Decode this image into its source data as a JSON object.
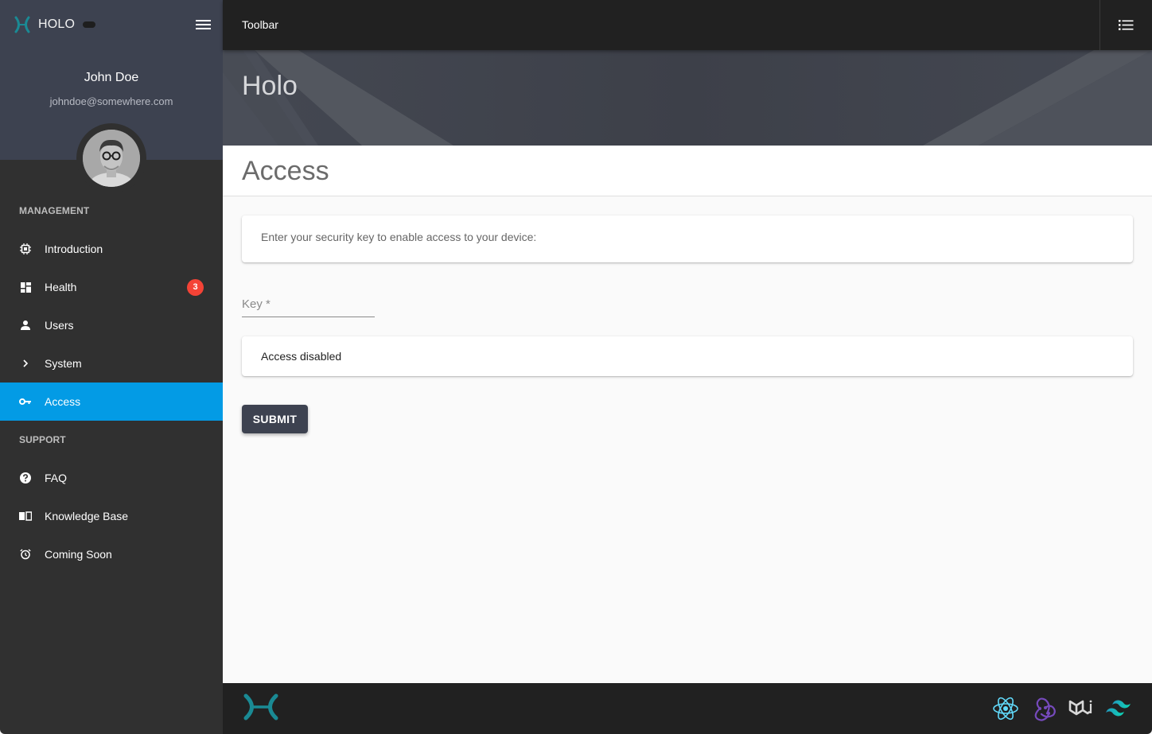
{
  "app": {
    "brand_name": "HOLO",
    "accent_color": "#039be5",
    "brand_color": "#1a8a94"
  },
  "sidebar": {
    "user": {
      "name": "John Doe",
      "email": "johndoe@somewhere.com"
    },
    "sections": [
      {
        "label": "MANAGEMENT",
        "items": [
          {
            "label": "Introduction",
            "icon": "chip-icon",
            "active": false
          },
          {
            "label": "Health",
            "icon": "dashboard-icon",
            "badge": "3",
            "active": false
          },
          {
            "label": "Users",
            "icon": "person-icon",
            "active": false
          },
          {
            "label": "System",
            "icon": "chevron-right-icon",
            "active": false
          },
          {
            "label": "Access",
            "icon": "key-icon",
            "active": true
          }
        ]
      },
      {
        "label": "SUPPORT",
        "items": [
          {
            "label": "FAQ",
            "icon": "help-circle-icon",
            "active": false
          },
          {
            "label": "Knowledge Base",
            "icon": "book-icon",
            "active": false
          },
          {
            "label": "Coming Soon",
            "icon": "alarm-clock-icon",
            "active": false
          }
        ]
      }
    ]
  },
  "toolbar": {
    "title": "Toolbar",
    "right_button_icon": "list-icon"
  },
  "banner": {
    "title": "Holo"
  },
  "page": {
    "title": "Access",
    "instruction": "Enter your security key to enable access to your device:",
    "key_field": {
      "label": "Key *",
      "value": ""
    },
    "status": "Access disabled",
    "submit_label": "SUBMIT"
  },
  "footer": {
    "logo_icon": "holo-logo-icon",
    "tech_icons": [
      "react-icon",
      "redux-icon",
      "material-ui-icon",
      "tailwind-icon"
    ]
  }
}
